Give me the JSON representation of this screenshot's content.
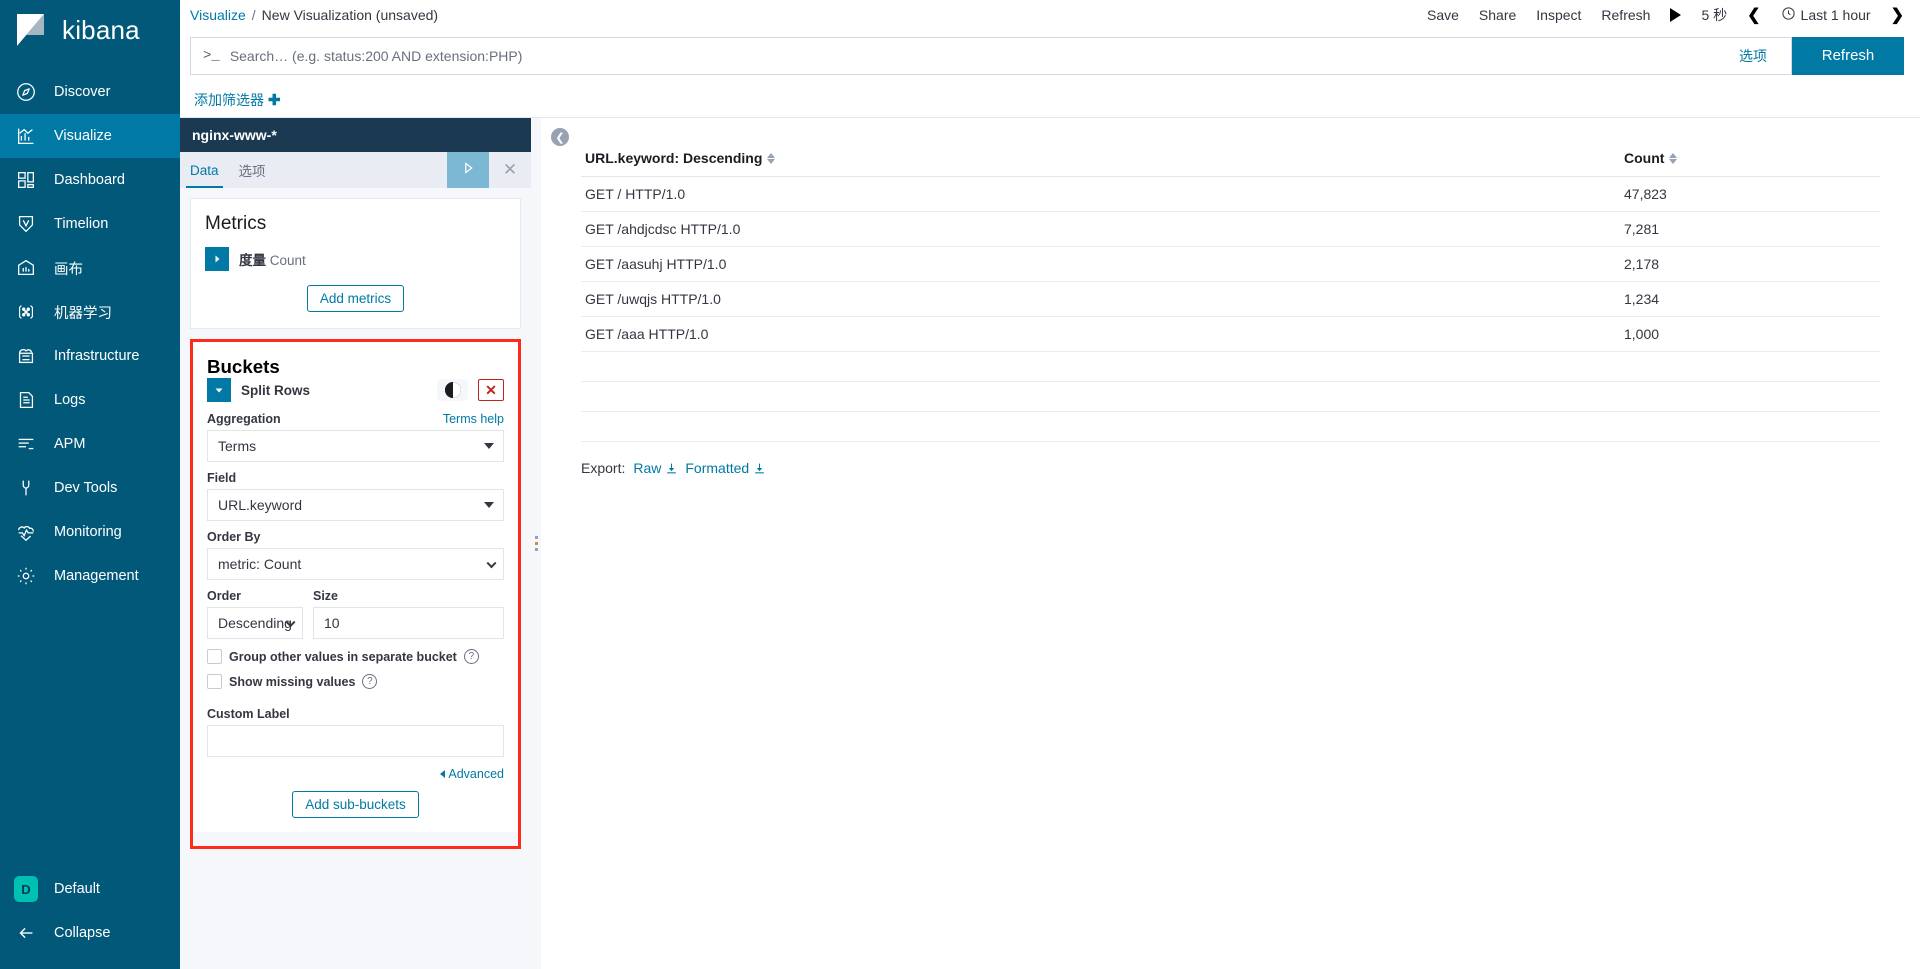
{
  "brand": {
    "name": "kibana",
    "logo_icon": "kibana-logo-icon"
  },
  "sidebar": {
    "items": [
      {
        "label": "Discover",
        "icon": "compass-icon",
        "active": false
      },
      {
        "label": "Visualize",
        "icon": "bar-chart-icon",
        "active": true
      },
      {
        "label": "Dashboard",
        "icon": "dashboard-icon",
        "active": false
      },
      {
        "label": "Timelion",
        "icon": "timelion-icon",
        "active": false
      },
      {
        "label": "画布",
        "icon": "canvas-icon",
        "active": false
      },
      {
        "label": "机器学习",
        "icon": "ml-icon",
        "active": false
      },
      {
        "label": "Infrastructure",
        "icon": "infra-icon",
        "active": false
      },
      {
        "label": "Logs",
        "icon": "logs-icon",
        "active": false
      },
      {
        "label": "APM",
        "icon": "apm-icon",
        "active": false
      },
      {
        "label": "Dev Tools",
        "icon": "wrench-icon",
        "active": false
      },
      {
        "label": "Monitoring",
        "icon": "heartbeat-icon",
        "active": false
      },
      {
        "label": "Management",
        "icon": "gear-icon",
        "active": false
      }
    ],
    "space": {
      "badge": "D",
      "label": "Default"
    },
    "collapse": {
      "label": "Collapse",
      "icon": "arrow-left-icon"
    }
  },
  "header": {
    "breadcrumb": {
      "root": "Visualize",
      "separator": "/",
      "current": "New Visualization (unsaved)"
    },
    "actions": [
      "Save",
      "Share",
      "Inspect",
      "Refresh"
    ],
    "auto_refresh_play_icon": "play-icon",
    "auto_refresh_interval": "5 秒",
    "prev_icon": "chevron-left-icon",
    "clock_icon": "clock-icon",
    "time_range": "Last 1 hour",
    "next_icon": "chevron-right-icon"
  },
  "query": {
    "prompt_glyph": ">_",
    "placeholder": "Search… (e.g. status:200 AND extension:PHP)",
    "value": "",
    "options_label": "选项",
    "refresh_label": "Refresh",
    "accent": "#0079a5"
  },
  "filters": {
    "add_filter_label": "添加筛选器",
    "add_icon": "plus-icon"
  },
  "editor": {
    "index_pattern": "nginx-www-*",
    "tabs": [
      {
        "label": "Data",
        "active": true
      },
      {
        "label": "选项",
        "active": false
      }
    ],
    "apply_icon": "play-triangle-icon",
    "discard_icon": "close-icon",
    "metrics": {
      "title": "Metrics",
      "items": [
        {
          "toggle_icon": "triangle-right-icon",
          "label": "度量",
          "value": "Count"
        }
      ],
      "add_button": "Add metrics"
    },
    "buckets": {
      "title": "Buckets",
      "highlight_color": "#ff2a17",
      "row": {
        "toggle_icon": "triangle-down-icon",
        "label": "Split Rows",
        "switch_icon": "toggle-icon",
        "remove_icon": "x-icon"
      },
      "aggregation": {
        "label": "Aggregation",
        "help": "Terms help",
        "value": "Terms"
      },
      "field": {
        "label": "Field",
        "value": "URL.keyword"
      },
      "order_by": {
        "label": "Order By",
        "value": "metric: Count"
      },
      "order": {
        "label": "Order",
        "value": "Descending"
      },
      "size": {
        "label": "Size",
        "value": "10"
      },
      "group_other": {
        "label": "Group other values in separate bucket",
        "checked": false,
        "help_icon": "question-icon"
      },
      "show_missing": {
        "label": "Show missing values",
        "checked": false,
        "help_icon": "question-icon"
      },
      "custom_label": {
        "label": "Custom Label",
        "value": "",
        "placeholder": ""
      },
      "advanced": {
        "label": "Advanced",
        "icon": "caret-left-icon"
      },
      "add_sub_buckets": "Add sub-buckets"
    }
  },
  "visualization": {
    "collapse_icon": "chevron-left-circle-icon",
    "resize_handle_icon": "grip-dots-icon",
    "export": {
      "label": "Export:",
      "raw": "Raw",
      "formatted": "Formatted",
      "download_icon": "download-icon"
    }
  },
  "chart_data": {
    "type": "table",
    "title": "",
    "columns": [
      "URL.keyword: Descending",
      "Count"
    ],
    "sort_icons": [
      "sort-icon",
      "sort-icon"
    ],
    "categories": [
      "GET / HTTP/1.0",
      "GET /ahdjcdsc HTTP/1.0",
      "GET /aasuhj HTTP/1.0",
      "GET /uwqjs HTTP/1.0",
      "GET /aaa HTTP/1.0"
    ],
    "values": [
      47823,
      7281,
      2178,
      1234,
      1000
    ],
    "rows": [
      {
        "key": "GET / HTTP/1.0",
        "count": "47,823"
      },
      {
        "key": "GET /ahdjcdsc HTTP/1.0",
        "count": "7,281"
      },
      {
        "key": "GET /aasuhj HTTP/1.0",
        "count": "2,178"
      },
      {
        "key": "GET /uwqjs HTTP/1.0",
        "count": "1,234"
      },
      {
        "key": "GET /aaa HTTP/1.0",
        "count": "1,000"
      }
    ],
    "xlabel": "URL.keyword: Descending",
    "ylabel": "Count"
  }
}
